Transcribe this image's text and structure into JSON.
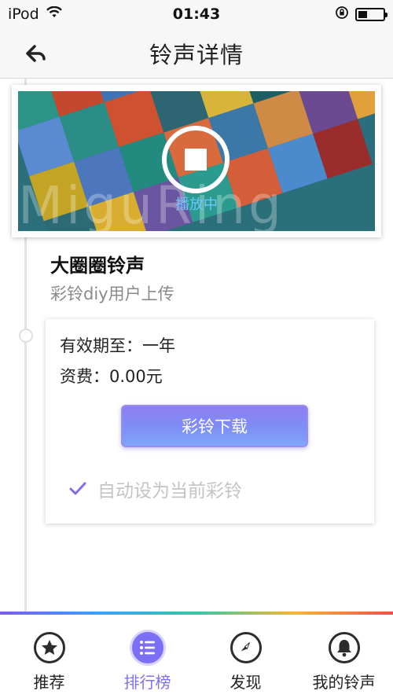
{
  "status_bar": {
    "carrier": "iPod",
    "time": "01:43"
  },
  "nav": {
    "title": "铃声详情"
  },
  "banner": {
    "status_text": "播放中",
    "watermark": "MiguRing"
  },
  "song": {
    "title": "大圈圈铃声",
    "subtitle": "彩铃diy用户上传"
  },
  "detail": {
    "validity": "有效期至：一年",
    "fee": "资费：0.00元",
    "download_label": "彩铃下载",
    "auto_set_label": "自动设为当前彩铃",
    "auto_set_checked": true
  },
  "tabs": [
    {
      "label": "推荐",
      "icon": "star-icon",
      "active": false
    },
    {
      "label": "排行榜",
      "icon": "list-icon",
      "active": true
    },
    {
      "label": "发现",
      "icon": "compass-icon",
      "active": false
    },
    {
      "label": "我的铃声",
      "icon": "bell-icon",
      "active": false
    }
  ],
  "colors": {
    "accent": "#7d6ff5",
    "playing_text": "#6fc6ff",
    "muted_text": "#8a8a8a"
  }
}
